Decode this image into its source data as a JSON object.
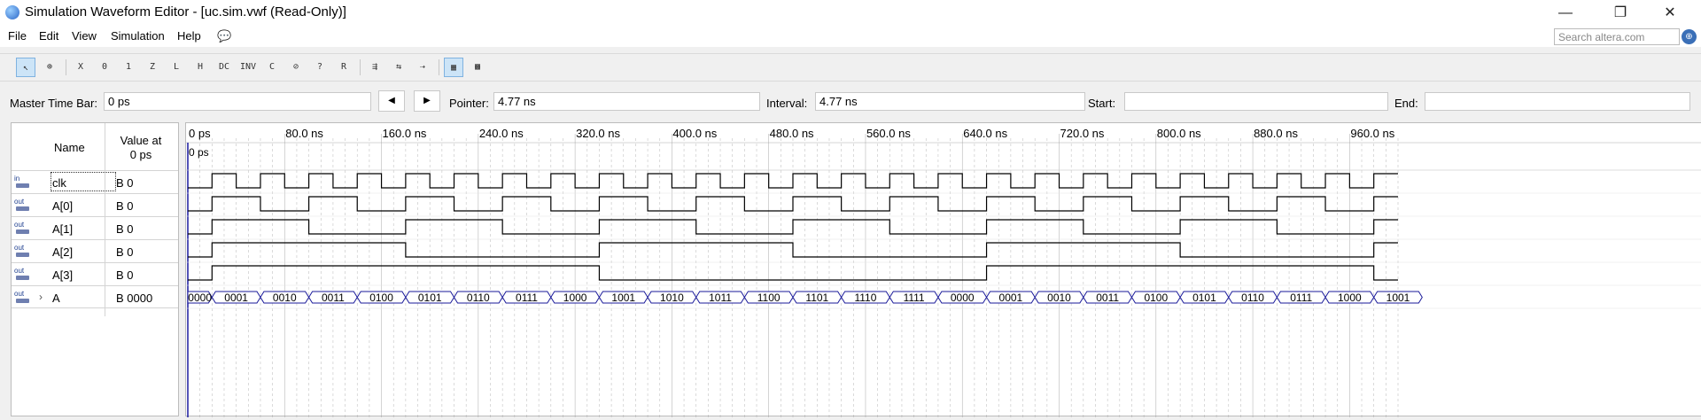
{
  "window": {
    "title": "Simulation Waveform Editor - [uc.sim.vwf (Read-Only)]",
    "minimize": "—",
    "restore": "❐",
    "close": "✕"
  },
  "menu": {
    "items": [
      "File",
      "Edit",
      "View",
      "Simulation",
      "Help"
    ],
    "search_placeholder": "Search altera.com",
    "search_icon": "globe-search-icon"
  },
  "toolbar": {
    "buttons": [
      {
        "name": "selection-tool",
        "glyph": "↖",
        "active": true
      },
      {
        "name": "zoom-tool",
        "glyph": "⊕",
        "active": false
      },
      {
        "name": "force-unknown",
        "glyph": "X",
        "active": false
      },
      {
        "name": "force-low",
        "glyph": "0",
        "active": false
      },
      {
        "name": "force-high",
        "glyph": "1",
        "active": false
      },
      {
        "name": "force-high-impedance",
        "glyph": "Z",
        "active": false
      },
      {
        "name": "force-weak-low",
        "glyph": "L",
        "active": false
      },
      {
        "name": "force-weak-high",
        "glyph": "H",
        "active": false
      },
      {
        "name": "force-dont-care",
        "glyph": "DC",
        "active": false
      },
      {
        "name": "invert",
        "glyph": "INV",
        "active": false
      },
      {
        "name": "count-value",
        "glyph": "C",
        "active": false
      },
      {
        "name": "clock-value",
        "glyph": "⊘",
        "active": false
      },
      {
        "name": "arbitrary-value",
        "glyph": "?",
        "active": false
      },
      {
        "name": "random-value",
        "glyph": "R",
        "active": false
      },
      {
        "name": "snap-to-grid",
        "glyph": "⇶",
        "active": false
      },
      {
        "name": "timing-analysis",
        "glyph": "⇆",
        "active": false
      },
      {
        "name": "functional-sim",
        "glyph": "⇢",
        "active": false
      },
      {
        "name": "grid-view",
        "glyph": "▦",
        "active": true
      },
      {
        "name": "report-view",
        "glyph": "▩",
        "active": false
      }
    ]
  },
  "timebar": {
    "master_label": "Master Time Bar:",
    "master_value": "0 ps",
    "prev_icon": "◀",
    "next_icon": "▶",
    "pointer_label": "Pointer:",
    "pointer_value": "4.77 ns",
    "interval_label": "Interval:",
    "interval_value": "4.77 ns",
    "start_label": "Start:",
    "start_value": "",
    "end_label": "End:",
    "end_value": ""
  },
  "grid": {
    "name_header": "Name",
    "value_header_line1": "Value at",
    "value_header_line2": "0 ps",
    "master_marker": "0 ps",
    "time_labels": [
      "0 ps",
      "80.0 ns",
      "160.0 ns",
      "240.0 ns",
      "320.0 ns",
      "400.0 ns",
      "480.0 ns",
      "560.0 ns",
      "640.0 ns",
      "720.0 ns",
      "800.0 ns",
      "880.0 ns",
      "960.0 ns"
    ],
    "signals": [
      {
        "dir": "in",
        "name": "clk",
        "value": "B 0",
        "expandable": false
      },
      {
        "dir": "out",
        "name": "A[0]",
        "value": "B 0",
        "expandable": false
      },
      {
        "dir": "out",
        "name": "A[1]",
        "value": "B 0",
        "expandable": false
      },
      {
        "dir": "out",
        "name": "A[2]",
        "value": "B 0",
        "expandable": false
      },
      {
        "dir": "out",
        "name": "A[3]",
        "value": "B 0",
        "expandable": false
      },
      {
        "dir": "out",
        "name": "A",
        "value": "B 0000",
        "expandable": true,
        "expand_icon": "›"
      }
    ],
    "clock_period_ns": 40,
    "clock_first_rise_ns": 20,
    "time_end_ns": 1000,
    "bus_values": [
      "0000",
      "0001",
      "0010",
      "0011",
      "0100",
      "0101",
      "0110",
      "0111",
      "1000",
      "1001",
      "1010",
      "1011",
      "1100",
      "1101",
      "1110",
      "1111",
      "0000",
      "0001",
      "0010",
      "0011",
      "0100",
      "0101",
      "0110",
      "0111",
      "1000",
      "1001"
    ],
    "colors": {
      "wave": "#000000",
      "bus": "#1a1a9a",
      "grid": "#9a9a9a",
      "cursor": "#1a1aa0"
    }
  }
}
